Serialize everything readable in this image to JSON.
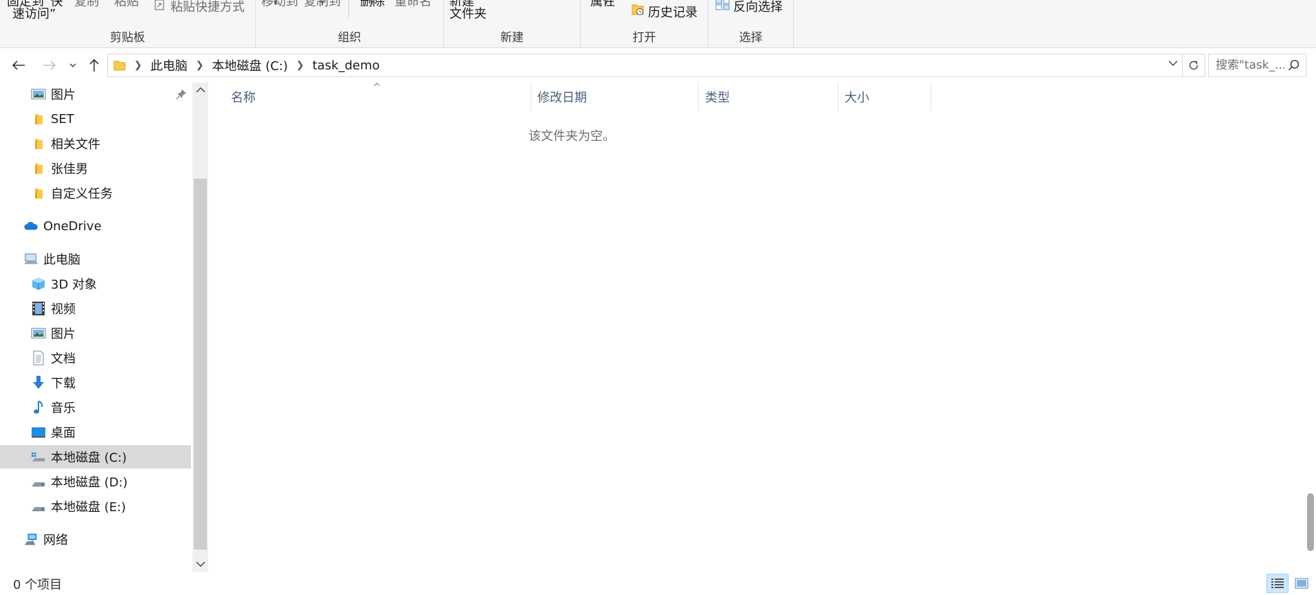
{
  "ribbon": {
    "clipboard": {
      "title": "剪贴板",
      "pin_quick_access_partial": "固定到“快",
      "pin_quick_access_line2": "速访问”",
      "copy_partial": "复制",
      "paste_partial": "粘贴",
      "paste_shortcut": "粘贴快捷方式"
    },
    "organize": {
      "title": "组织",
      "move_to_partial": "移动到",
      "copy_to_partial": "复制到",
      "delete_partial": "删除",
      "rename_partial": "重命名"
    },
    "new": {
      "title": "新建",
      "new_folder_partial": "新建",
      "new_folder_line2": "文件夹"
    },
    "open": {
      "title": "打开",
      "properties_partial": "属性",
      "history": "历史记录"
    },
    "select": {
      "title": "选择",
      "invert_selection": "反向选择"
    }
  },
  "address": {
    "crumbs": [
      "此电脑",
      "本地磁盘 (C:)",
      "task_demo"
    ],
    "search_placeholder": "搜索\"task_..."
  },
  "nav": {
    "items": [
      {
        "label": "图片",
        "icon": "pictures-icon",
        "pinned": true
      },
      {
        "label": "SET",
        "icon": "folder-icon"
      },
      {
        "label": "相关文件",
        "icon": "folder-icon"
      },
      {
        "label": "张佳男",
        "icon": "folder-icon"
      },
      {
        "label": "自定义任务",
        "icon": "folder-icon"
      },
      {
        "label": "OneDrive",
        "icon": "onedrive-icon"
      },
      {
        "label": "此电脑",
        "icon": "this-pc-icon"
      },
      {
        "label": "3D 对象",
        "icon": "3d-objects-icon"
      },
      {
        "label": "视频",
        "icon": "videos-icon"
      },
      {
        "label": "图片",
        "icon": "pictures-icon"
      },
      {
        "label": "文档",
        "icon": "documents-icon"
      },
      {
        "label": "下载",
        "icon": "downloads-icon"
      },
      {
        "label": "音乐",
        "icon": "music-icon"
      },
      {
        "label": "桌面",
        "icon": "desktop-icon"
      },
      {
        "label": "本地磁盘 (C:)",
        "icon": "drive-c-icon",
        "selected": true
      },
      {
        "label": "本地磁盘 (D:)",
        "icon": "drive-icon"
      },
      {
        "label": "本地磁盘 (E:)",
        "icon": "drive-icon"
      },
      {
        "label": "网络",
        "icon": "network-icon"
      }
    ]
  },
  "content": {
    "columns": [
      "名称",
      "修改日期",
      "类型",
      "大小"
    ],
    "empty_message": "该文件夹为空。"
  },
  "status": {
    "item_count": "0 个项目"
  },
  "colors": {
    "ribbon_bg": "#f5f6f7",
    "selected_bg": "#d9d9d9",
    "column_header_text": "#4c607a",
    "folder_yellow": "#f8c94a",
    "onedrive_blue": "#1b76d6",
    "active_view_bg": "#cce8ff"
  }
}
